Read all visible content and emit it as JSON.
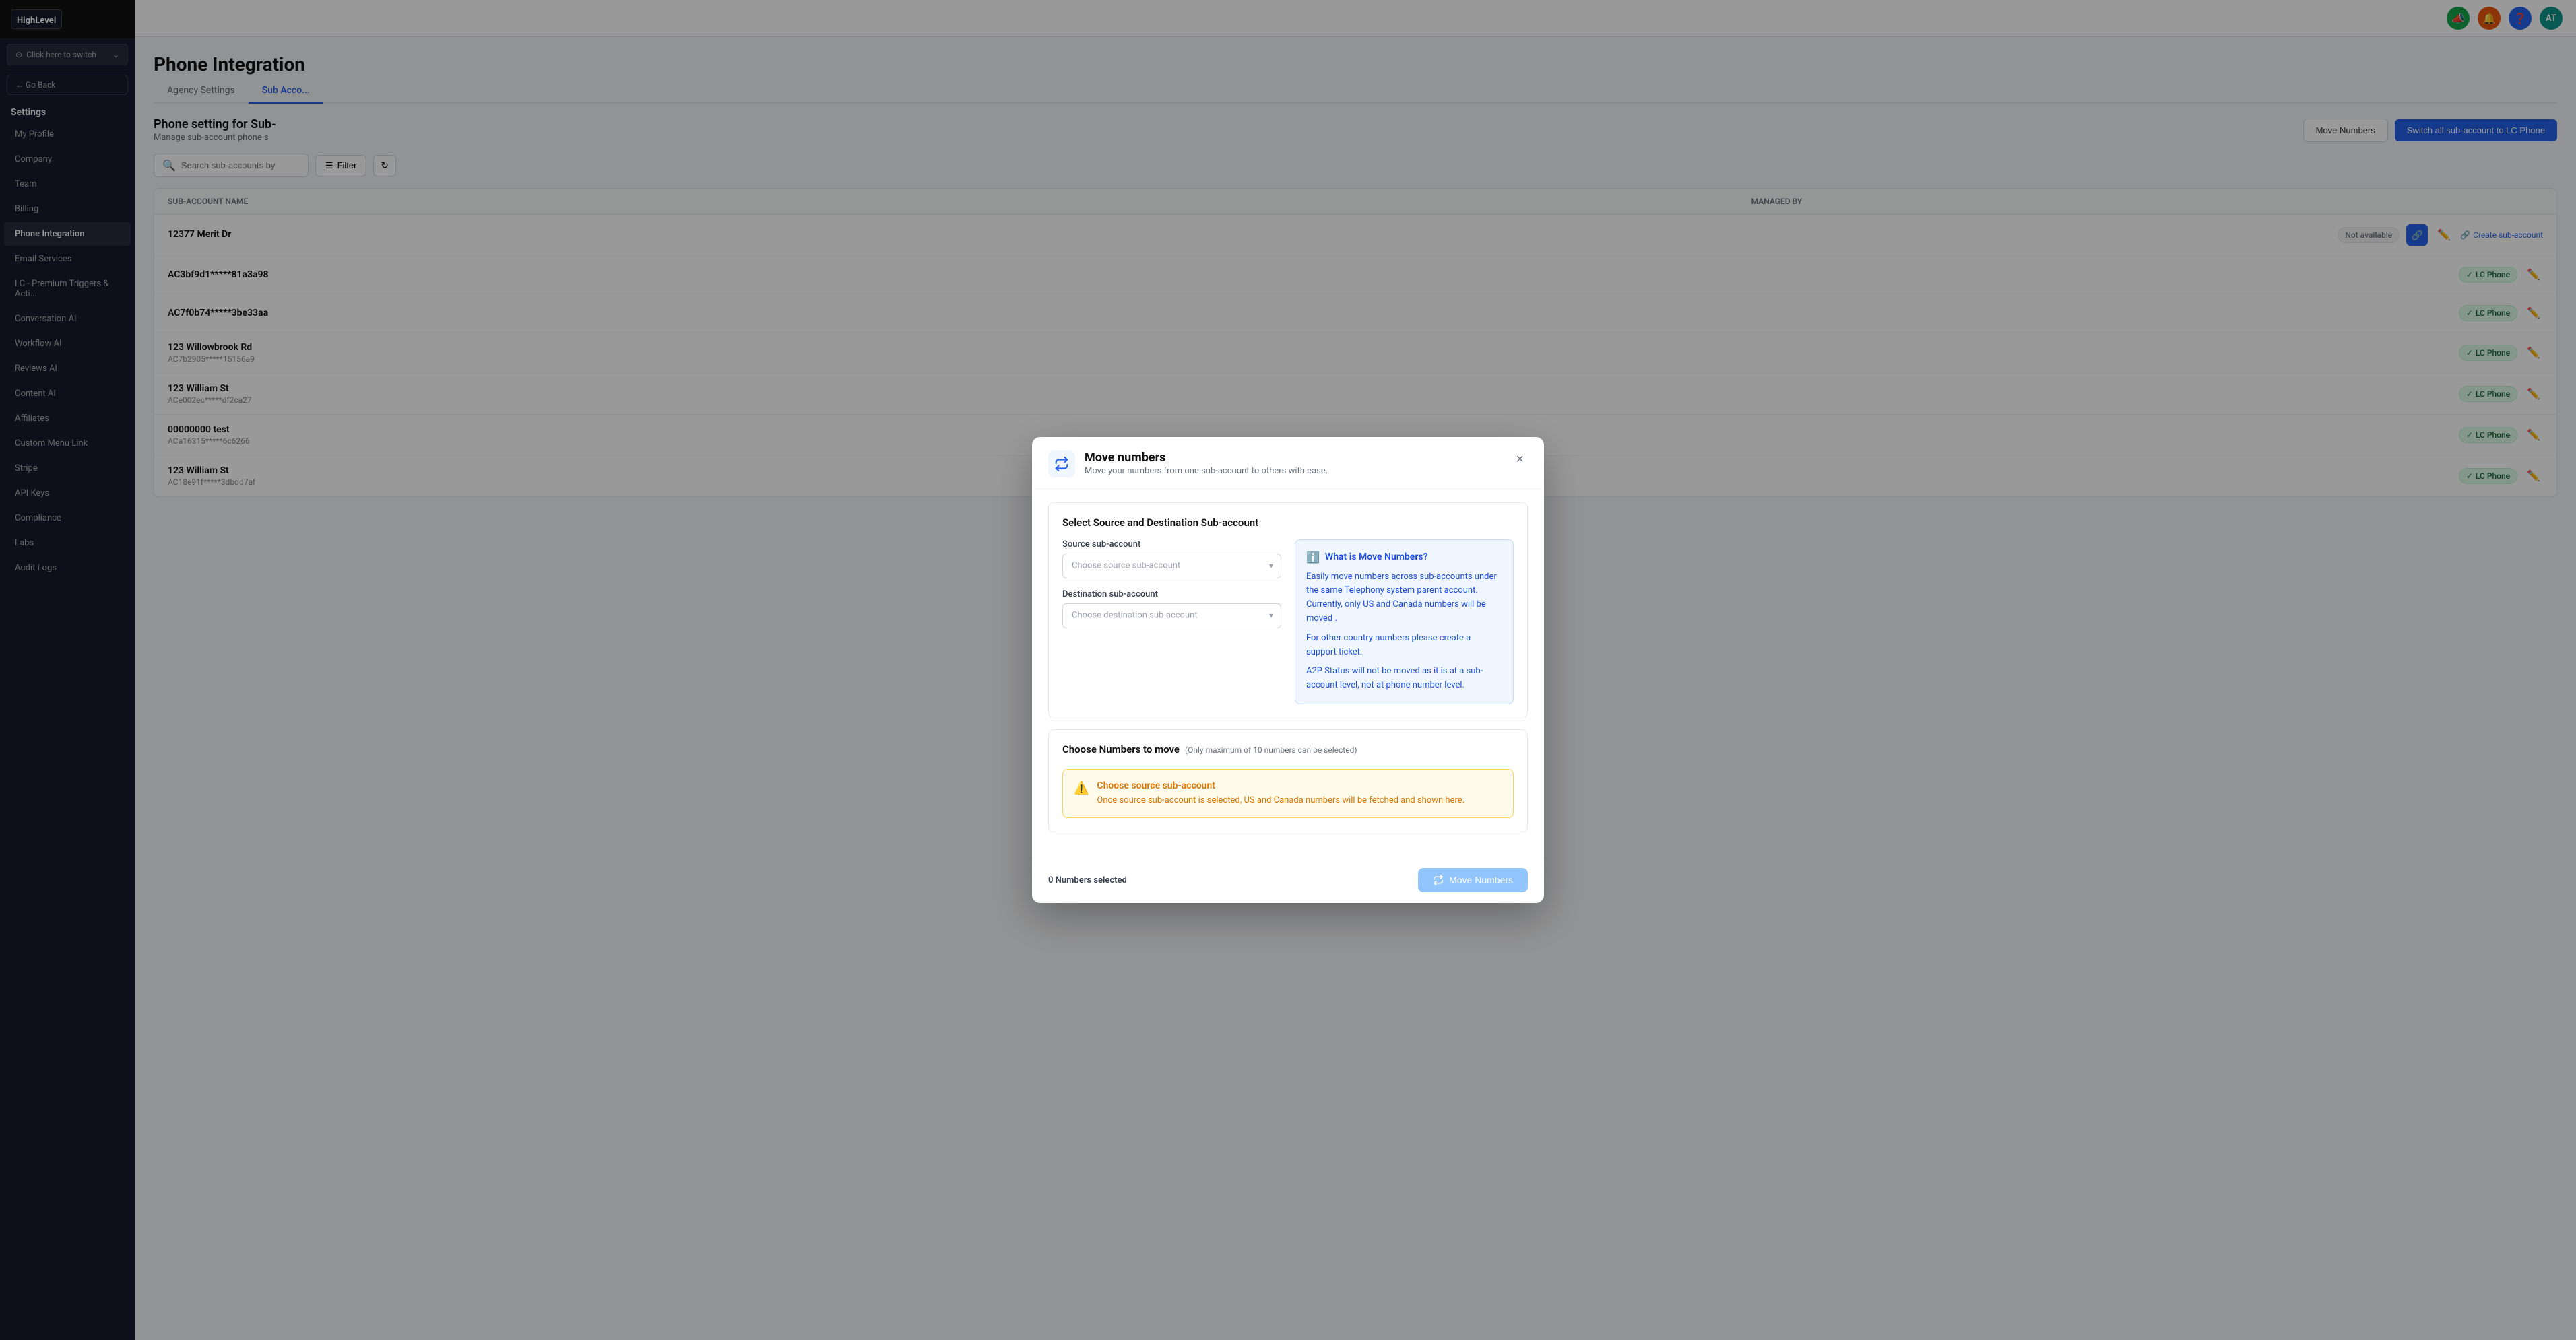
{
  "app": {
    "logo_text": "HighLevel"
  },
  "sidebar": {
    "switch_label": "Click here to switch",
    "go_back": "← Go Back",
    "section_title": "Settings",
    "items": [
      {
        "id": "my-profile",
        "label": "My Profile",
        "active": false
      },
      {
        "id": "company",
        "label": "Company",
        "active": false
      },
      {
        "id": "team",
        "label": "Team",
        "active": false
      },
      {
        "id": "billing",
        "label": "Billing",
        "active": false
      },
      {
        "id": "phone-integration",
        "label": "Phone Integration",
        "active": true
      },
      {
        "id": "email-services",
        "label": "Email Services",
        "active": false
      },
      {
        "id": "lc-premium",
        "label": "LC - Premium Triggers & Acti...",
        "active": false
      },
      {
        "id": "conversation-ai",
        "label": "Conversation AI",
        "active": false
      },
      {
        "id": "workflow-ai",
        "label": "Workflow AI",
        "active": false
      },
      {
        "id": "reviews-ai",
        "label": "Reviews AI",
        "active": false
      },
      {
        "id": "content-ai",
        "label": "Content AI",
        "active": false
      },
      {
        "id": "affiliates",
        "label": "Affiliates",
        "active": false
      },
      {
        "id": "custom-menu",
        "label": "Custom Menu Link",
        "active": false
      },
      {
        "id": "stripe",
        "label": "Stripe",
        "active": false
      },
      {
        "id": "api-keys",
        "label": "API Keys",
        "active": false
      },
      {
        "id": "compliance",
        "label": "Compliance",
        "active": false
      },
      {
        "id": "labs",
        "label": "Labs",
        "active": false
      },
      {
        "id": "audit-logs",
        "label": "Audit Logs",
        "active": false
      }
    ]
  },
  "topbar": {
    "icons": [
      "📣",
      "🔔",
      "❓"
    ],
    "avatar_text": "AT"
  },
  "page": {
    "title": "Phone Integration",
    "subtitle": "",
    "tabs": [
      {
        "id": "agency-settings",
        "label": "Agency Settings",
        "active": false
      },
      {
        "id": "sub-accounts",
        "label": "Sub Acco...",
        "active": true
      }
    ],
    "section_title": "Phone setting for Sub-",
    "section_desc": "Manage sub-account phone s"
  },
  "actions": {
    "move_numbers_label": "Move Numbers",
    "switch_all_label": "Switch all sub-account to LC Phone",
    "search_placeholder": "Search sub-accounts by",
    "filter_label": "Filter"
  },
  "table": {
    "headers": [
      "Sub-Account Name",
      "",
      "Managed by"
    ],
    "rows": [
      {
        "name": "12377 Merit Dr",
        "id": "",
        "badge": "not-available",
        "badge_text": "Not available",
        "has_link_icon": true,
        "has_create": true,
        "create_text": "Create sub-account"
      },
      {
        "name": "AC3bf9d1*****81a3a98",
        "id": "",
        "badge": "lc-phone",
        "badge_text": "LC Phone",
        "has_link_icon": false,
        "has_create": false,
        "create_text": ""
      },
      {
        "name": "AC7f0b74*****3be33aa",
        "id": "",
        "badge": "lc-phone",
        "badge_text": "LC Phone",
        "has_link_icon": false,
        "has_create": false,
        "create_text": ""
      },
      {
        "name": "123 Willowbrook Rd",
        "id": "AC7b2905*****15156a9",
        "badge": "lc-phone",
        "badge_text": "LC Phone",
        "has_link_icon": false,
        "has_create": false,
        "create_text": ""
      },
      {
        "name": "123 William St",
        "id": "ACe002ec*****df2ca27",
        "badge": "lc-phone",
        "badge_text": "LC Phone",
        "has_link_icon": false,
        "has_create": false,
        "create_text": ""
      },
      {
        "name": "00000000 test",
        "id": "ACa16315*****6c6266",
        "badge": "lc-phone",
        "badge_text": "LC Phone",
        "has_link_icon": false,
        "has_create": false,
        "create_text": ""
      },
      {
        "name": "123 William St",
        "id": "AC18e91f*****3dbdd7af",
        "badge": "lc-phone",
        "badge_text": "LC Phone",
        "has_link_icon": false,
        "has_create": false,
        "create_text": ""
      }
    ]
  },
  "modal": {
    "title": "Move numbers",
    "subtitle": "Move your numbers from one sub-account to others with ease.",
    "close_label": "×",
    "card1_title": "Select Source and Destination Sub-account",
    "source_label": "Source sub-account",
    "source_placeholder": "Choose source sub-account",
    "destination_label": "Destination sub-account",
    "destination_placeholder": "Choose destination sub-account",
    "info_title": "What is Move Numbers?",
    "info_text1": "Easily move numbers across sub-accounts under the same Telephony system parent account. Currently, only US and Canada numbers will be moved .",
    "info_text2": "For other country numbers please create a support ticket.",
    "info_text3": "A2P Status will not be moved as it is at a sub-account level, not at phone number level.",
    "choose_title": "Choose Numbers to move",
    "choose_subtitle": "(Only maximum of 10 numbers can be selected)",
    "warning_title": "Choose source sub-account",
    "warning_text": "Once source sub-account is selected, US and Canada numbers will be fetched and shown here.",
    "numbers_selected": "0",
    "numbers_selected_label": "Numbers selected",
    "move_btn_label": "Move Numbers"
  }
}
